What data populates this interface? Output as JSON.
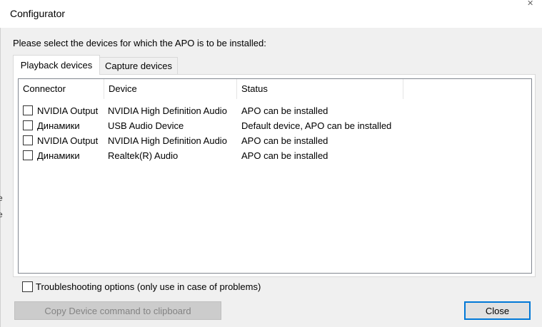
{
  "window": {
    "title": "Configurator",
    "close_glyph": "✕"
  },
  "instruction": "Please select the devices for which the APO is to be installed:",
  "background_fragments": [
    "e",
    "e"
  ],
  "tabs": [
    {
      "label": "Playback devices",
      "active": true
    },
    {
      "label": "Capture devices",
      "active": false
    }
  ],
  "table": {
    "columns": [
      "Connector",
      "Device",
      "Status"
    ],
    "rows": [
      {
        "checked": false,
        "connector": "NVIDIA Output",
        "device": "NVIDIA High Definition Audio",
        "status": "APO can be installed"
      },
      {
        "checked": false,
        "connector": "Динамики",
        "device": "USB Audio Device",
        "status": "Default device, APO can be installed"
      },
      {
        "checked": false,
        "connector": "NVIDIA Output",
        "device": "NVIDIA High Definition Audio",
        "status": "APO can be installed"
      },
      {
        "checked": false,
        "connector": "Динамики",
        "device": "Realtek(R) Audio",
        "status": "APO can be installed"
      }
    ]
  },
  "troubleshooting": {
    "label": "Troubleshooting options (only use in case of problems)",
    "checked": false
  },
  "buttons": {
    "copy_label": "Copy Device command to clipboard",
    "copy_enabled": false,
    "close_label": "Close"
  },
  "colors": {
    "accent_focus": "#0078d7",
    "window_bg": "#f0f0f0",
    "disabled_button_bg": "#cccccc"
  }
}
